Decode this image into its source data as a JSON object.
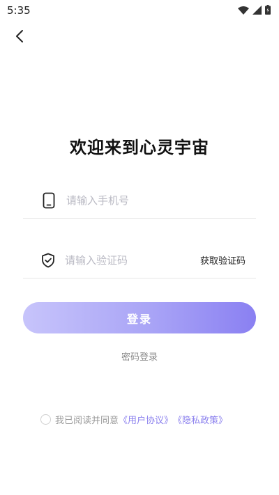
{
  "status_bar": {
    "time": "5:35",
    "icons": [
      "wifi-icon",
      "cellular-signal-icon",
      "battery-icon"
    ]
  },
  "nav": {
    "back_icon": "chevron-left-icon"
  },
  "title": "欢迎来到心灵宇宙",
  "phone_field": {
    "icon": "phone-icon",
    "placeholder": "请输入手机号",
    "value": ""
  },
  "code_field": {
    "icon": "shield-check-icon",
    "placeholder": "请输入验证码",
    "value": "",
    "get_code_label": "获取验证码"
  },
  "login_button": {
    "label": "登录"
  },
  "password_login": {
    "label": "密码登录"
  },
  "agreement": {
    "checked": false,
    "prefix": "我已阅读并同意",
    "user_agreement": "《用户协议》",
    "privacy_policy": "《隐私政策》"
  },
  "colors": {
    "accent": "#8b80ee",
    "button_gradient_start": "#c7c4fb",
    "button_gradient_end": "#8a80f2",
    "placeholder": "#b9b9c3",
    "muted_text": "#9a9a9a"
  }
}
